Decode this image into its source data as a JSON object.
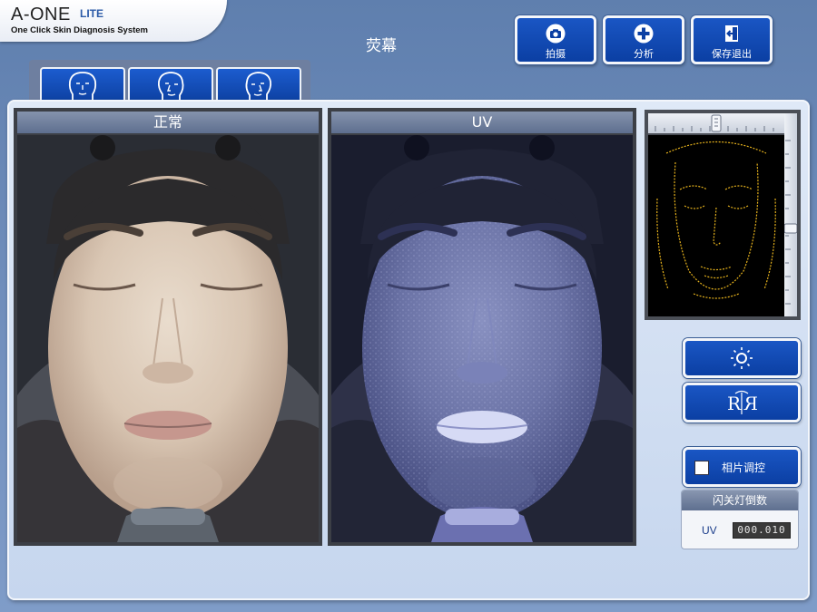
{
  "app": {
    "name": "A-ONE",
    "edition": "LITE",
    "tagline": "One Click Skin Diagnosis System"
  },
  "mode_title": "荧幕",
  "toolbar": {
    "capture_label": "拍摄",
    "analyze_label": "分析",
    "save_exit_label": "保存退出"
  },
  "tabs": [
    {
      "name": "face-front-tab"
    },
    {
      "name": "face-left-tab"
    },
    {
      "name": "face-right-tab"
    }
  ],
  "viewers": {
    "normal": {
      "title": "正常"
    },
    "uv": {
      "title": "UV"
    }
  },
  "controls": {
    "brightness_icon": "sun-icon",
    "mirror_icon": "mirror-r-icon",
    "photo_adjust_label": "相片调控"
  },
  "flash_countdown": {
    "title": "闪关灯倒数",
    "mode": "UV",
    "value": "000.010"
  },
  "colors": {
    "button_blue": "#0b3fa3",
    "edge_line": "#e6b21c",
    "background": "#6f8dbb"
  }
}
